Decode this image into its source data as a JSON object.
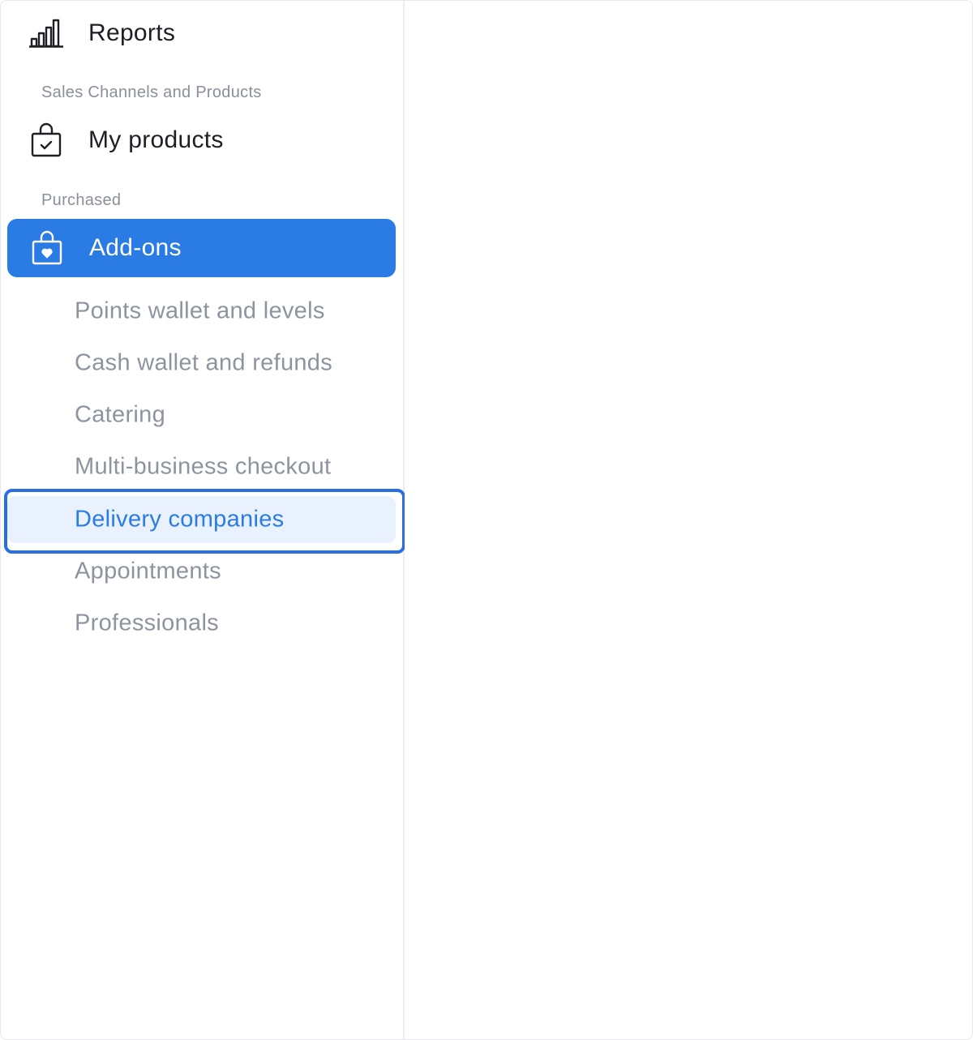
{
  "sidebar": {
    "top_items": [
      {
        "label": "Reports",
        "icon": "bar-chart-icon"
      },
      {
        "label": "My products",
        "icon": "shopping-bag-check-icon"
      },
      {
        "label": "Add-ons",
        "icon": "shopping-bag-heart-icon",
        "active": true
      }
    ],
    "sections": {
      "sales_channels": "Sales Channels and Products",
      "purchased": "Purchased"
    },
    "sub_items": [
      {
        "label": "Points wallet and levels"
      },
      {
        "label": "Cash wallet and refunds"
      },
      {
        "label": "Catering"
      },
      {
        "label": "Multi-business checkout"
      },
      {
        "label": "Delivery companies",
        "selected": true
      },
      {
        "label": "Appointments"
      },
      {
        "label": "Professionals"
      }
    ]
  },
  "colors": {
    "accent": "#2a7be4",
    "selected_bg": "#e9f1fd",
    "muted_text": "#8d94a0",
    "focus_ring": "#2a6fe0"
  }
}
